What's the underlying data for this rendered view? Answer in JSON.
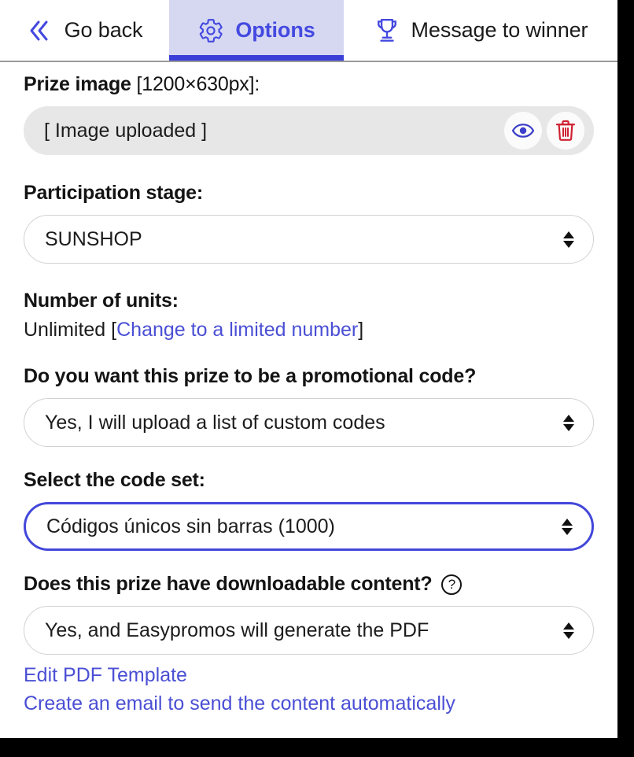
{
  "theme": {
    "accent": "#4449e0",
    "tab_active_bg": "#d6d8f2",
    "tab_underline": "#3b3fd8",
    "link": "#4a4fd4",
    "danger": "#cf2030",
    "field_bg": "#e7e7e7",
    "page_bg": "#ffffff",
    "frame": "#000000"
  },
  "tabs": [
    {
      "id": "go-back",
      "label": "Go back",
      "icon": "double-chevron-left-icon",
      "active": false
    },
    {
      "id": "options",
      "label": "Options",
      "icon": "gear-icon",
      "active": true
    },
    {
      "id": "message-to-winner",
      "label": "Message to winner",
      "icon": "trophy-icon",
      "active": false
    }
  ],
  "form": {
    "prize_image": {
      "label": "Prize image",
      "dimensions": "[1200×630px]:",
      "value": "[ Image uploaded ]",
      "preview_icon": "eye-icon",
      "delete_icon": "trash-icon"
    },
    "participation_stage": {
      "label": "Participation stage:",
      "value": "SUNSHOP"
    },
    "number_of_units": {
      "label": "Number of units:",
      "value": "Unlimited ",
      "bracket_open": "[",
      "link": "Change to a limited number",
      "bracket_close": "]"
    },
    "promotional_code": {
      "label": "Do you want this prize to be a promotional code?",
      "value": "Yes, I will upload a list of custom codes"
    },
    "code_set": {
      "label": "Select the code set:",
      "value": "Códigos únicos sin barras (1000)",
      "focused": true
    },
    "downloadable_content": {
      "label": "Does this prize have downloadable content?",
      "help_icon": "question-mark-icon",
      "help_glyph": "?",
      "value": "Yes, and Easypromos will generate the PDF"
    },
    "links": [
      {
        "id": "edit-pdf-template",
        "label": "Edit PDF Template"
      },
      {
        "id": "create-email",
        "label": "Create an email to send the content automatically"
      }
    ]
  }
}
